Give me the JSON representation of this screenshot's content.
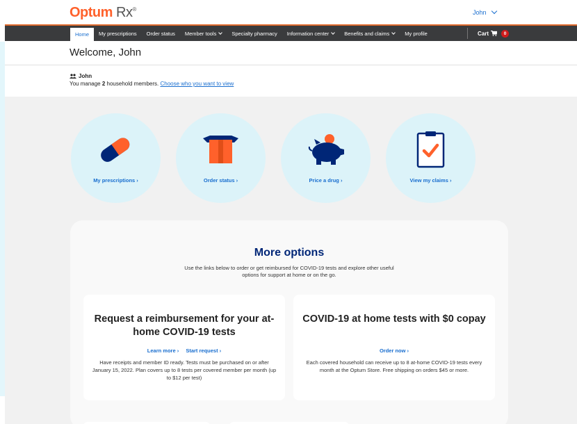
{
  "header": {
    "logo_brand": "Optum",
    "logo_rx": "Rx",
    "logo_mark": "®",
    "user_name": "John"
  },
  "nav": {
    "items": [
      {
        "label": "Home",
        "active": true,
        "dropdown": false
      },
      {
        "label": "My prescriptions",
        "active": false,
        "dropdown": false
      },
      {
        "label": "Order status",
        "active": false,
        "dropdown": false
      },
      {
        "label": "Member tools",
        "active": false,
        "dropdown": true
      },
      {
        "label": "Specialty pharmacy",
        "active": false,
        "dropdown": false
      },
      {
        "label": "Information center",
        "active": false,
        "dropdown": true
      },
      {
        "label": "Benefits and claims",
        "active": false,
        "dropdown": true
      },
      {
        "label": "My profile",
        "active": false,
        "dropdown": false
      }
    ],
    "cart_label": "Cart",
    "cart_count": "0"
  },
  "welcome": {
    "title": "Welcome, John"
  },
  "household": {
    "name": "John",
    "text_prefix": "You manage ",
    "count": "2",
    "text_suffix": " household members. ",
    "link": "Choose who you want to view"
  },
  "quick_links": [
    {
      "label": "My prescriptions ›",
      "icon": "pill-icon"
    },
    {
      "label": "Order status ›",
      "icon": "package-icon"
    },
    {
      "label": "Price a drug ›",
      "icon": "piggy-bank-icon"
    },
    {
      "label": "View my claims ›",
      "icon": "clipboard-check-icon"
    }
  ],
  "more_options": {
    "title": "More options",
    "subtitle": "Use the links below to order or get reimbursed for COVID-19 tests and explore other useful options for support at home or on the go.",
    "cards": [
      {
        "title": "Request a reimbursement for your at-home COVID-19 tests",
        "links": [
          "Learn more ›",
          "Start request ›"
        ],
        "body": "Have receipts and member ID ready. Tests must be purchased on or after January 15, 2022. Plan covers up to 8 tests per covered member per month (up to $12 per test)"
      },
      {
        "title": "COVID-19 at home tests with $0 copay",
        "links": [
          "Order now ›"
        ],
        "body": "Each covered household can receive up to 8 at-home COVID-19 tests every month at the Optum Store. Free shipping on orders $45 or more."
      }
    ]
  },
  "colors": {
    "brand_orange": "#ff612b",
    "nav_bg": "#3a3b3d",
    "link_blue": "#196ecf",
    "heading_navy": "#002677",
    "circle_bg": "#dcf3f9",
    "icon_navy": "#002677",
    "icon_orange": "#ff612b",
    "cart_badge": "#d01c1c"
  }
}
